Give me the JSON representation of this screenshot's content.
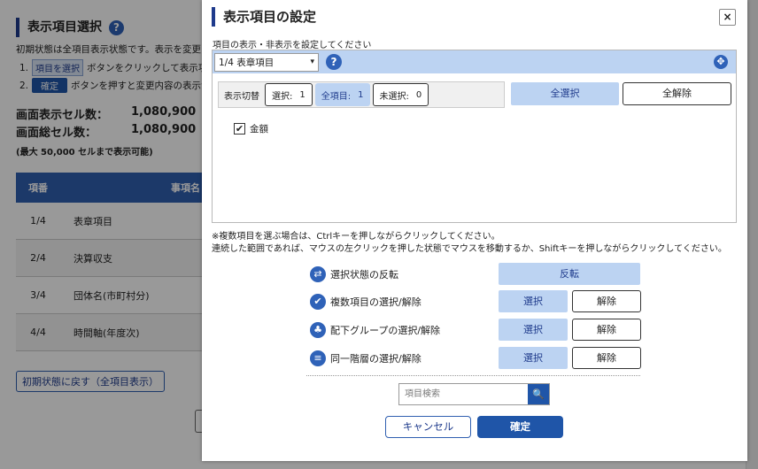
{
  "background": {
    "title": "表示項目選択",
    "description": "初期状態は全項目表示状態です。表示を変更す",
    "step1": {
      "num": "1.",
      "chip": "項目を選択",
      "text": "ボタンをクリックして表示項目を"
    },
    "step2": {
      "num": "2.",
      "chip": "確定",
      "text": "ボタンを押すと変更内容の表示が"
    },
    "stats": [
      {
        "label": "画面表示セル数：",
        "value": "1,080,900"
      },
      {
        "label": "画面総セル数：",
        "value": "1,080,900"
      }
    ],
    "note": "(最大 50,000 セルまで表示可能)",
    "table": {
      "headers": [
        "項番",
        "事項名"
      ],
      "rows": [
        [
          "1/4",
          "表章項目"
        ],
        [
          "2/4",
          "決算収支"
        ],
        [
          "3/4",
          "団体名(市町村分)"
        ],
        [
          "4/4",
          "時間軸(年度次)"
        ]
      ]
    },
    "reset_label": "初期状態に戻す（全項目表示）"
  },
  "modal": {
    "title": "表示項目の設定",
    "close_label": "×",
    "subtitle": "項目の表示・非表示を設定してください",
    "selector": {
      "value": "1/4 表章項目",
      "arrow": "▾"
    },
    "help_icon": "?",
    "expand_icon": "✥",
    "toggle": {
      "label": "表示切替",
      "selected_label": "選択:",
      "selected_count": "1",
      "all_label": "全項目:",
      "all_count": "1",
      "unselected_label": "未選択:",
      "unselected_count": "0"
    },
    "select_all_label": "全選択",
    "clear_all_label": "全解除",
    "items": [
      {
        "label": "金額",
        "checked": true,
        "mark": "✔"
      }
    ],
    "notes": [
      "※複数項目を選ぶ場合は、Ctrlキーを押しながらクリックしてください。",
      "連続した範囲であれば、マウスの左クリックを押した状態でマウスを移動するか、Shiftキーを押しながらクリックしてください。"
    ],
    "operations": [
      {
        "icon": "⇄",
        "label": "選択状態の反転",
        "primary": "反転"
      },
      {
        "icon": "✔",
        "label": "複数項目の選択/解除",
        "primary": "選択",
        "secondary": "解除"
      },
      {
        "icon": "♣",
        "label": "配下グループの選択/解除",
        "primary": "選択",
        "secondary": "解除"
      },
      {
        "icon": "≡",
        "label": "同一階層の選択/解除",
        "primary": "選択",
        "secondary": "解除"
      }
    ],
    "search": {
      "placeholder": "項目検索",
      "icon": "🔍"
    },
    "cancel_label": "キャンセル",
    "ok_label": "確定"
  },
  "colors": {
    "accent": "#1f55a8",
    "accent_light": "#bcd3f2",
    "title_bar": "#1f3b8c"
  }
}
